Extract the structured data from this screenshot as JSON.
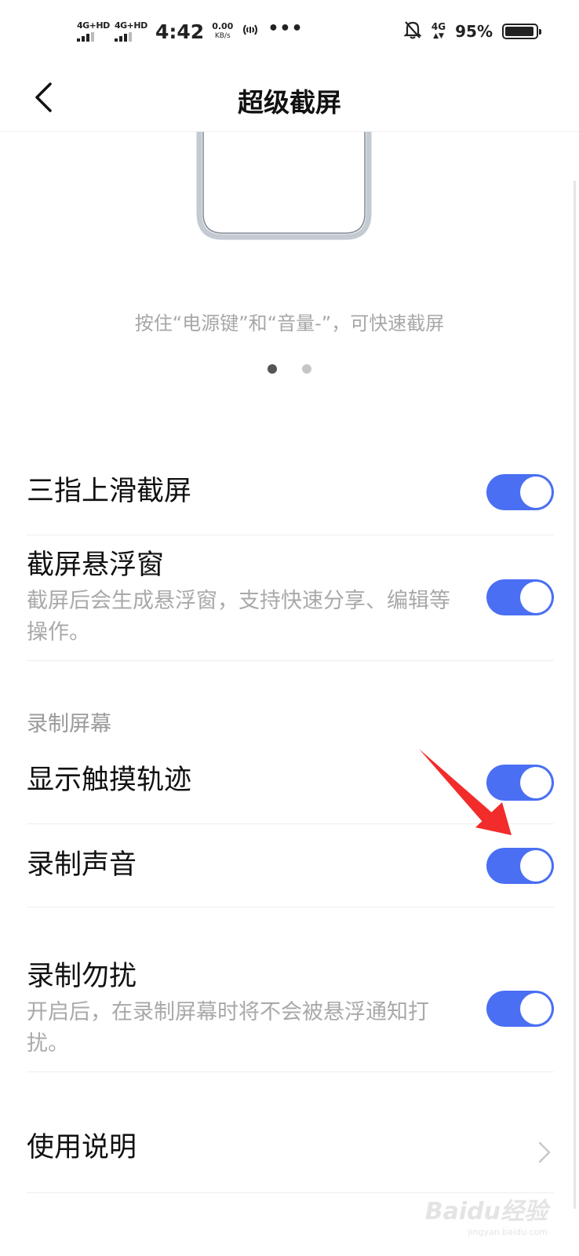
{
  "status_bar": {
    "sim1_label": "4G+HD",
    "sim2_label": "4G+HD",
    "time": "4:42",
    "speed_value": "0.00",
    "speed_unit": "KB/s",
    "hotspot_icon": "hotspot-icon",
    "more_glyph": "•••",
    "mute_icon": "bell-off-icon",
    "network_label": "4G",
    "network_arrows": "▲▼",
    "battery_percent": "95%",
    "battery_level": 0.95
  },
  "header": {
    "title": "超级截屏",
    "back_icon": "chevron-left-icon"
  },
  "illustration": {
    "caption": "按住“电源键”和“音量-”，可快速截屏",
    "page_count": 2,
    "active_page": 1
  },
  "settings": {
    "three_finger": {
      "title": "三指上滑截屏",
      "enabled": true
    },
    "float_window": {
      "title": "截屏悬浮窗",
      "desc": "截屏后会生成悬浮窗，支持快速分享、编辑等操作。",
      "enabled": true
    },
    "section_record": "录制屏幕",
    "touch_track": {
      "title": "显示触摸轨迹",
      "enabled": true
    },
    "record_sound": {
      "title": "录制声音",
      "enabled": true
    },
    "record_dnd": {
      "title": "录制勿扰",
      "desc": "开启后，在录制屏幕时将不会被悬浮通知打扰。",
      "enabled": true
    },
    "usage_guide": {
      "title": "使用说明",
      "icon": "chevron-right-icon"
    }
  },
  "colors": {
    "accent": "#4a6ff2",
    "annotation": "#f22b2b",
    "secondary_text": "#a9a9a9"
  },
  "watermark": {
    "text": "Baidu经验",
    "sub": "jingyan.baidu.com"
  }
}
